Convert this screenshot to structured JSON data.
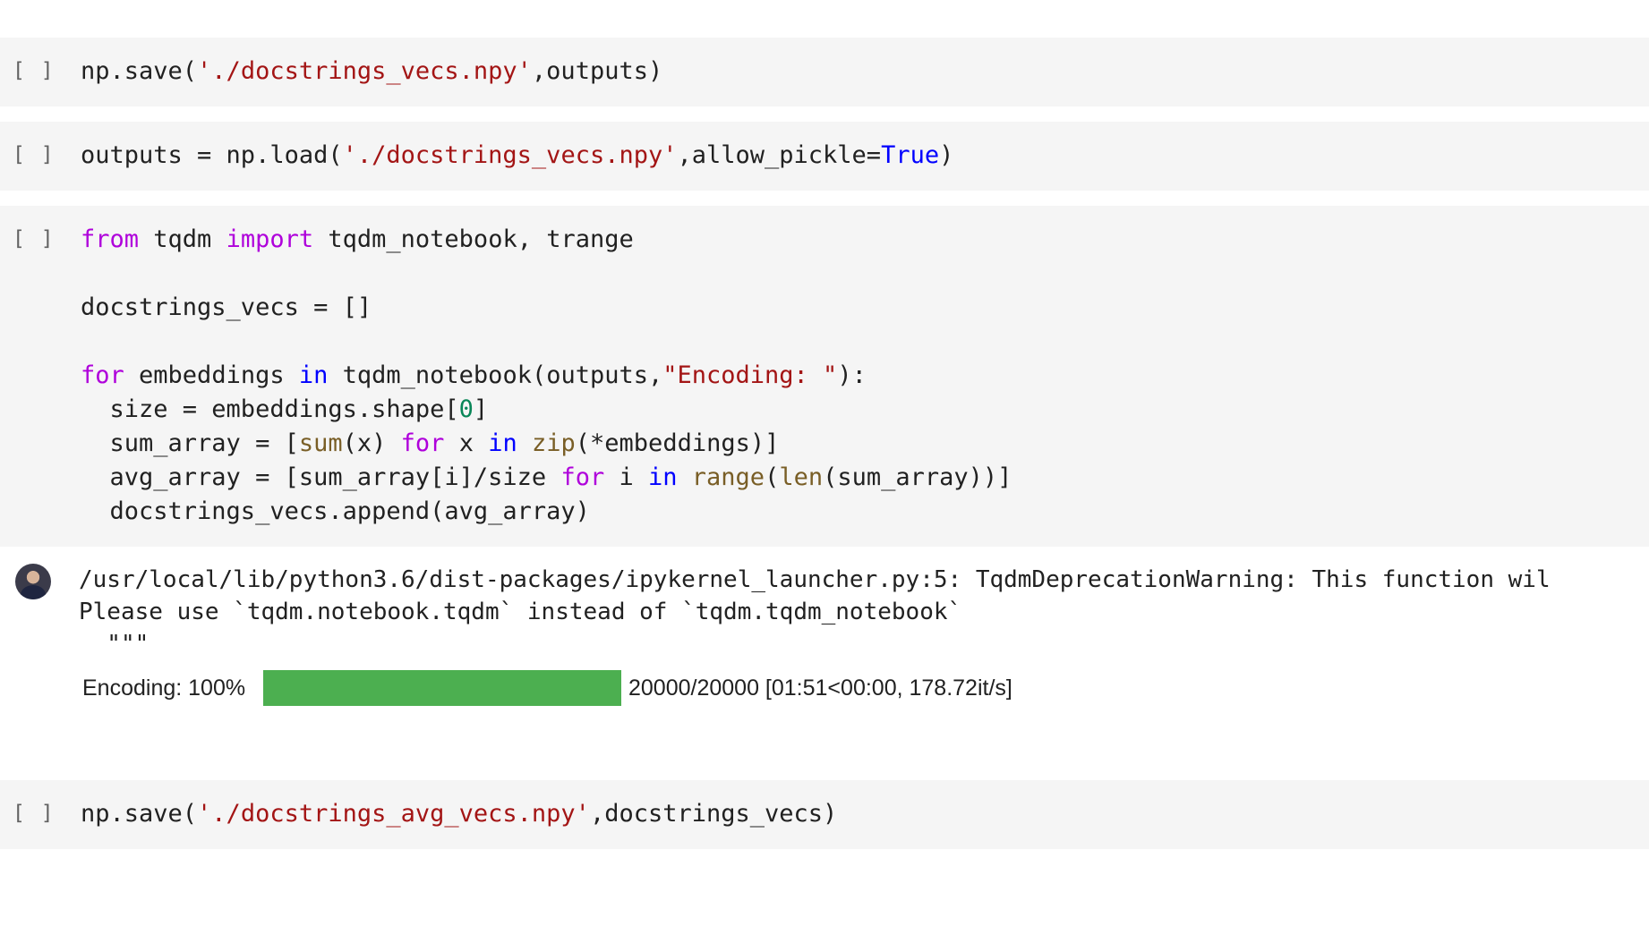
{
  "cells": [
    {
      "indicator": "[ ]",
      "lines": [
        [
          {
            "t": "np.save("
          },
          {
            "t": "'./docstrings_vecs.npy'",
            "c": "str"
          },
          {
            "t": ",outputs)"
          }
        ]
      ]
    },
    {
      "indicator": "[ ]",
      "lines": [
        [
          {
            "t": "outputs = np.load("
          },
          {
            "t": "'./docstrings_vecs.npy'",
            "c": "str"
          },
          {
            "t": ",allow_pickle="
          },
          {
            "t": "True",
            "c": "kw2"
          },
          {
            "t": ")"
          }
        ]
      ]
    },
    {
      "indicator": "[ ]",
      "lines": [
        [
          {
            "t": "from",
            "c": "kw"
          },
          {
            "t": " tqdm "
          },
          {
            "t": "import",
            "c": "kw"
          },
          {
            "t": " tqdm_notebook, trange"
          }
        ],
        [],
        [
          {
            "t": "docstrings_vecs = []"
          }
        ],
        [],
        [
          {
            "t": "for",
            "c": "kw"
          },
          {
            "t": " embeddings "
          },
          {
            "t": "in",
            "c": "kw2"
          },
          {
            "t": " tqdm_notebook(outputs,"
          },
          {
            "t": "\"Encoding: \"",
            "c": "str"
          },
          {
            "t": "):"
          }
        ],
        [
          {
            "t": "  size = embeddings.shape["
          },
          {
            "t": "0",
            "c": "num"
          },
          {
            "t": "]"
          }
        ],
        [
          {
            "t": "  sum_array = ["
          },
          {
            "t": "sum",
            "c": "bi"
          },
          {
            "t": "(x) "
          },
          {
            "t": "for",
            "c": "kw"
          },
          {
            "t": " x "
          },
          {
            "t": "in",
            "c": "kw2"
          },
          {
            "t": " "
          },
          {
            "t": "zip",
            "c": "bi"
          },
          {
            "t": "(*embeddings)]"
          }
        ],
        [
          {
            "t": "  avg_array = [sum_array[i]/size "
          },
          {
            "t": "for",
            "c": "kw"
          },
          {
            "t": " i "
          },
          {
            "t": "in",
            "c": "kw2"
          },
          {
            "t": " "
          },
          {
            "t": "range",
            "c": "bi"
          },
          {
            "t": "("
          },
          {
            "t": "len",
            "c": "bi"
          },
          {
            "t": "(sum_array))]"
          }
        ],
        [
          {
            "t": "  docstrings_vecs.append(avg_array)"
          }
        ]
      ]
    },
    {
      "indicator": "[ ]",
      "lines": [
        [
          {
            "t": "np.save("
          },
          {
            "t": "'./docstrings_avg_vecs.npy'",
            "c": "str"
          },
          {
            "t": ",docstrings_vecs)"
          }
        ]
      ]
    }
  ],
  "output": {
    "warning_lines": [
      "/usr/local/lib/python3.6/dist-packages/ipykernel_launcher.py:5: TqdmDeprecationWarning: This function wil",
      "Please use `tqdm.notebook.tqdm` instead of `tqdm.tqdm_notebook`",
      "  \"\"\""
    ],
    "progress": {
      "label": "Encoding: 100%",
      "fraction": 1.0,
      "stats": "20000/20000 [01:51<00:00, 178.72it/s]",
      "color": "#4caf50"
    }
  }
}
